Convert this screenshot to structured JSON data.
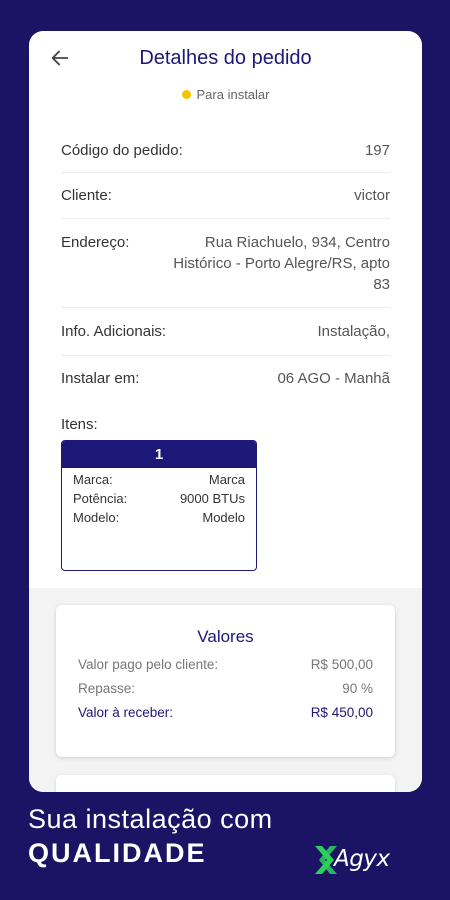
{
  "header": {
    "title": "Detalhes do pedido",
    "status": "Para instalar"
  },
  "details": [
    {
      "label": "Código do pedido:",
      "value": "197"
    },
    {
      "label": "Cliente:",
      "value": "victor"
    },
    {
      "label": "Endereço:",
      "value": "Rua Riachuelo, 934, Centro Histórico - Porto Alegre/RS, apto 83"
    },
    {
      "label": "Info. Adicionais:",
      "value": "Instalação,"
    },
    {
      "label": "Instalar em:",
      "value": "06 AGO - Manhã"
    }
  ],
  "items": {
    "label": "Itens:",
    "list": [
      {
        "number": "1",
        "fields": [
          {
            "label": "Marca:",
            "value": "Marca"
          },
          {
            "label": "Potência:",
            "value": "9000 BTUs"
          },
          {
            "label": "Modelo:",
            "value": "Modelo"
          }
        ]
      }
    ]
  },
  "values": {
    "title": "Valores",
    "rows": [
      {
        "label": "Valor pago pelo cliente:",
        "value": "R$ 500,00"
      },
      {
        "label": "Repasse:",
        "value": "90 %"
      },
      {
        "label": "Valor à receber:",
        "value": "R$ 450,00"
      }
    ]
  },
  "promo": {
    "line1": "Sua instalação com",
    "line2": "QUALIDADE",
    "brand": "Agyx"
  },
  "colors": {
    "background": "#1b1464",
    "accent": "#1d1777",
    "status_dot": "#f5c200",
    "logo_green": "#2bd15a"
  }
}
